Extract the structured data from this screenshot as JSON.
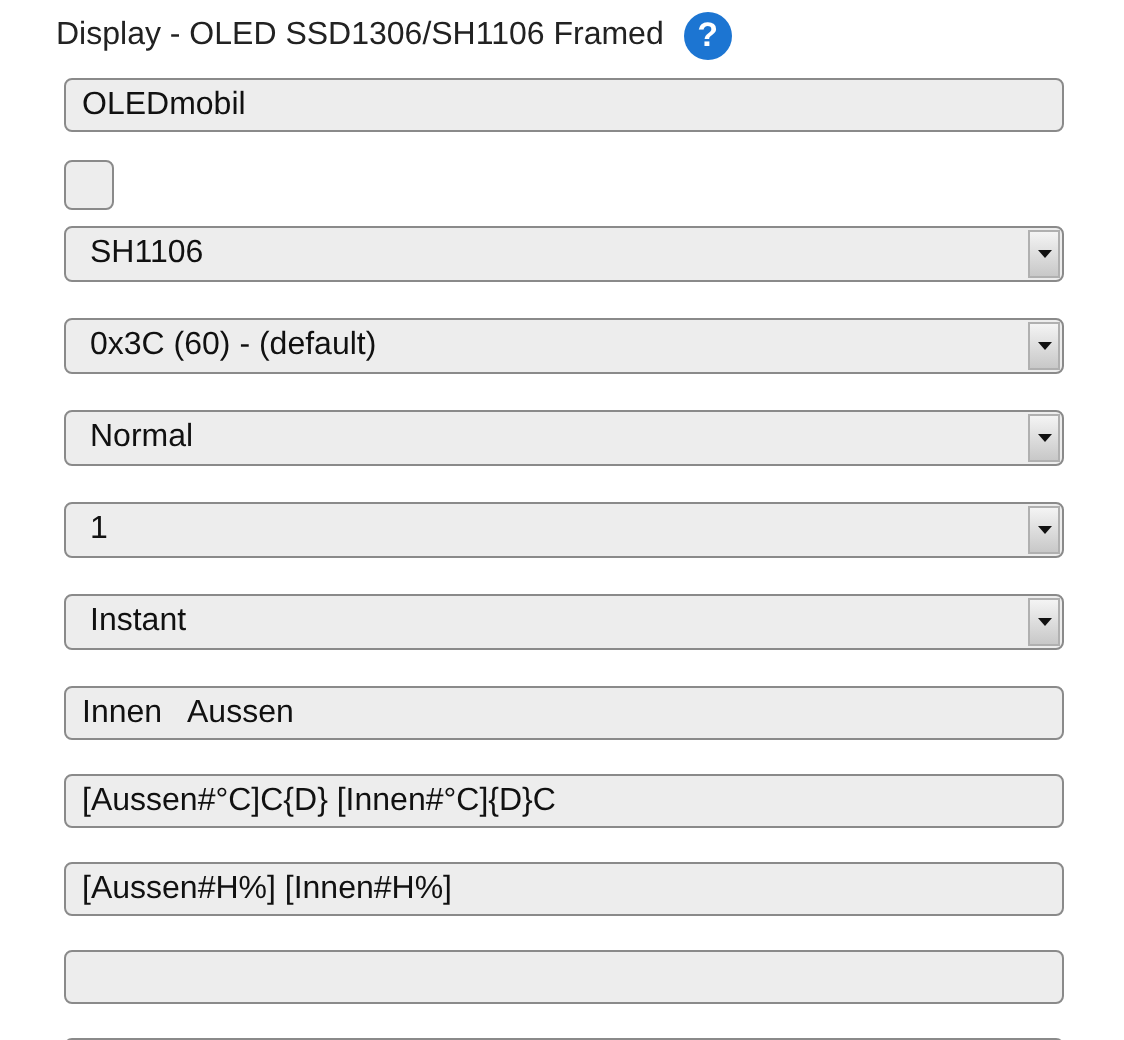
{
  "title": "Display - OLED SSD1306/SH1106 Framed",
  "help": {
    "label": "?"
  },
  "fields": [
    {
      "kind": "text",
      "value": "OLEDmobil"
    },
    {
      "kind": "checkbox",
      "checked": false
    },
    {
      "kind": "select",
      "value": "SH1106"
    },
    {
      "kind": "select",
      "value": "0x3C (60) - (default)"
    },
    {
      "kind": "select",
      "value": "Normal"
    },
    {
      "kind": "select",
      "value": "1"
    },
    {
      "kind": "select",
      "value": "Instant"
    },
    {
      "kind": "text",
      "value": "Innen   Aussen"
    },
    {
      "kind": "text",
      "value": "[Aussen#°C]C{D} [Innen#°C]{D}C"
    },
    {
      "kind": "text",
      "value": "[Aussen#H%] [Innen#H%]"
    },
    {
      "kind": "text"
    },
    {
      "kind": "text"
    }
  ]
}
